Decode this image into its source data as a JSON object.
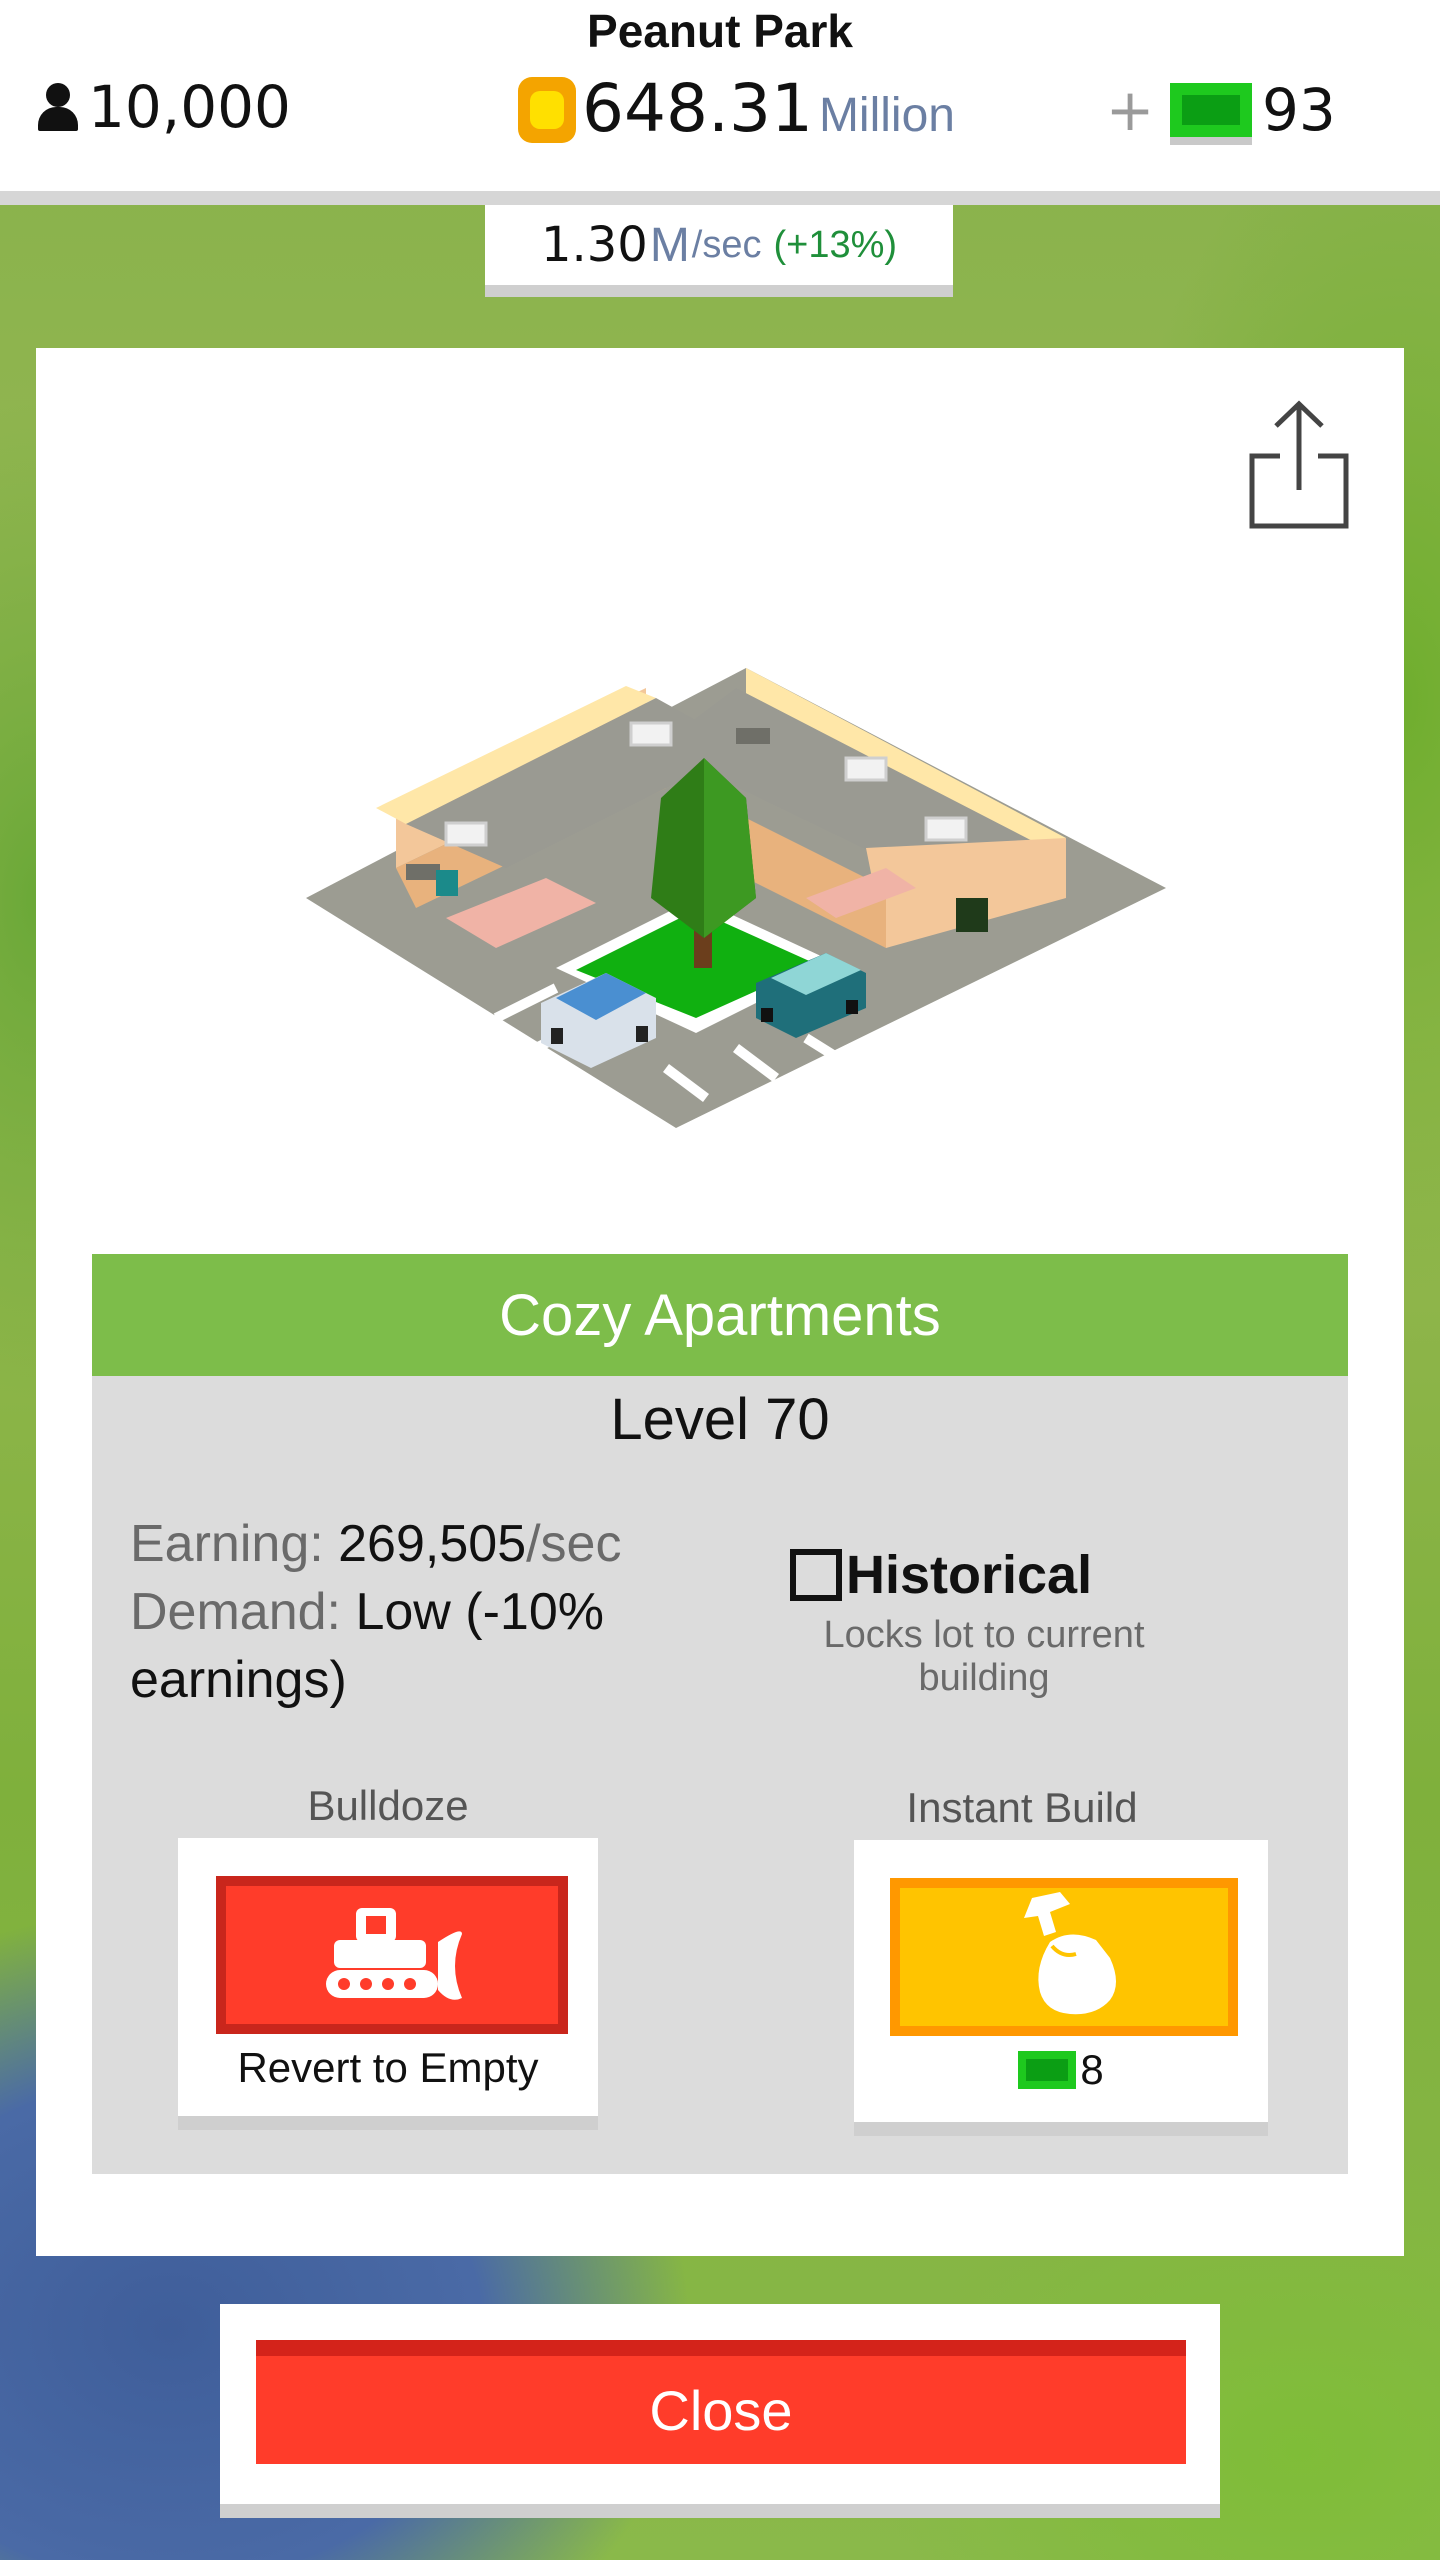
{
  "header": {
    "city_name": "Peanut Park",
    "population": "10,000",
    "money_value": "648.31",
    "money_unit": "Million",
    "add_cash_label": "+",
    "cash_value": "93"
  },
  "income": {
    "rate_value": "1.30",
    "rate_unit": "M",
    "rate_unit_suffix": "/sec",
    "rate_bonus": "(+13%)"
  },
  "building": {
    "name": "Cozy Apartments",
    "level": "Level 70",
    "earning_label": "Earning:",
    "earning_value": "269,505",
    "earning_unit": "/sec",
    "demand_label": "Demand:",
    "demand_value": "Low (-10% earnings)"
  },
  "historical": {
    "label": "Historical",
    "description": "Locks lot to current building",
    "checked": false
  },
  "actions": {
    "bulldoze_caption": "Bulldoze",
    "bulldoze_label": "Revert to Empty",
    "instant_caption": "Instant Build",
    "instant_cost": "8"
  },
  "close_label": "Close",
  "colors": {
    "accent_green": "#7dbd4a",
    "danger_red": "#ff3c2a",
    "gold": "#ffc400",
    "cash_green": "#1ec91e"
  },
  "icons": {
    "population": "person-icon",
    "money": "coin-icon",
    "cash": "bill-icon",
    "share": "share-icon",
    "bulldoze": "bulldozer-icon",
    "instant_build": "hammer-hand-icon"
  }
}
